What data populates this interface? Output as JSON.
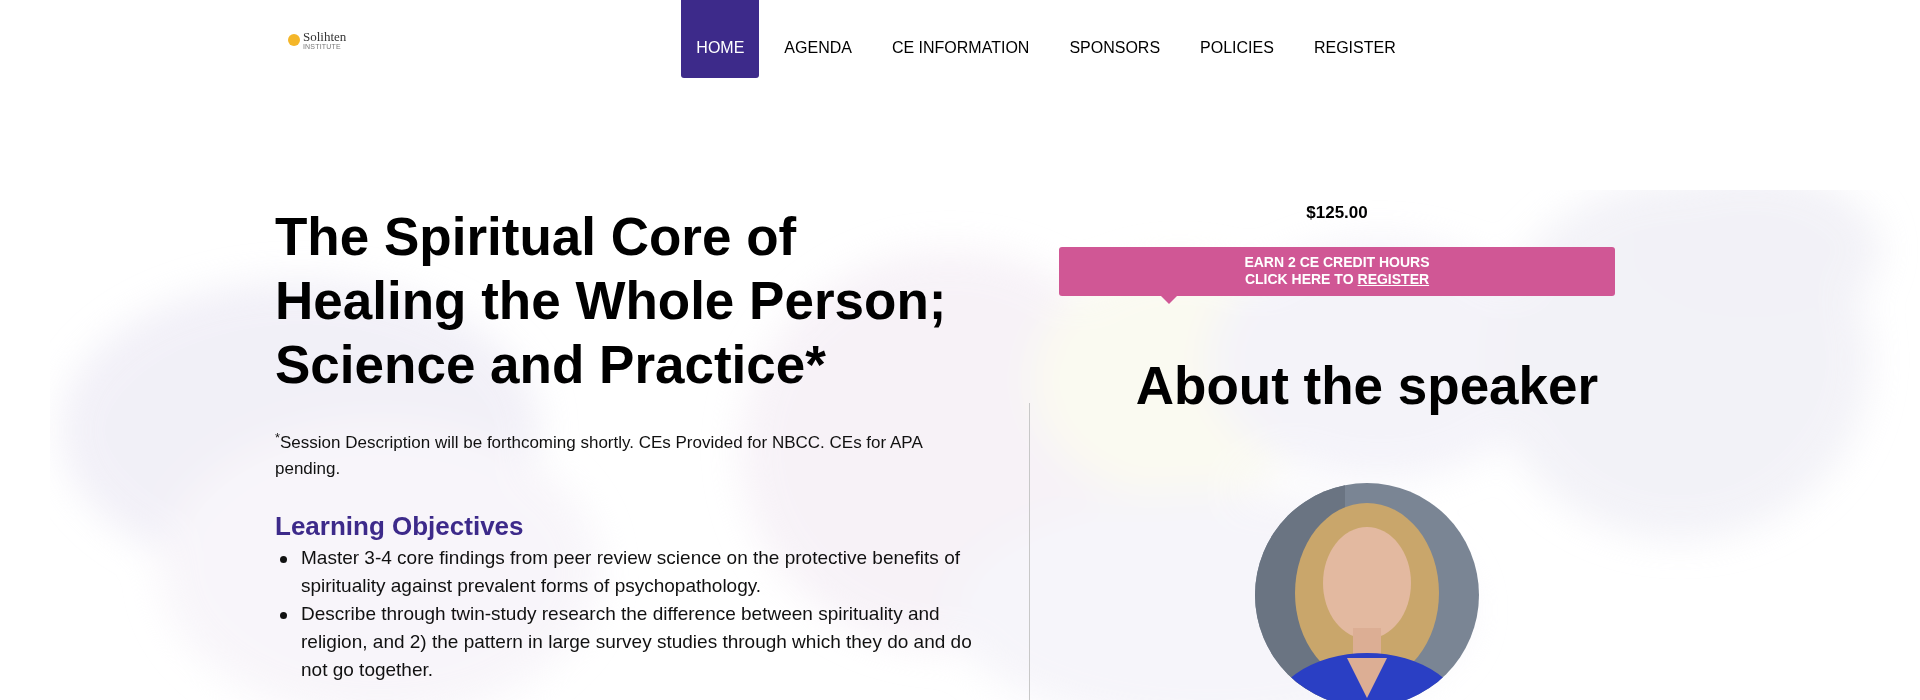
{
  "logo": {
    "name": "Solihten",
    "tagline": "INSTITUTE"
  },
  "nav": [
    {
      "label": "HOME",
      "selected": true
    },
    {
      "label": "AGENDA",
      "selected": false
    },
    {
      "label": "CE INFORMATION",
      "selected": false
    },
    {
      "label": "SPONSORS",
      "selected": false
    },
    {
      "label": "POLICIES",
      "selected": false
    },
    {
      "label": "REGISTER",
      "selected": false
    }
  ],
  "title": "The Spiritual Core of Healing the Whole Person; Science and Practice*",
  "footnote": "$^{*}$Session Description will be forthcoming shortly. CEs Provided for NBCC. CEs for APA pending.",
  "objectives": {
    "heading": "Learning Objectives",
    "items": [
      "Master 3-4 core findings from peer review science on the protective benefits of spirituality against prevalent forms of psychopathology.",
      "Describe through twin-study research the difference between spirituality and religion, and 2) the pattern in large survey studies through which they do and do not go together."
    ]
  },
  "price": "$125.00",
  "banner": {
    "line_1": "EARN 2 CE CREDIT HOURS",
    "line_2": "CLICK HERE TO",
    "link": "REGISTER"
  },
  "speaker": {
    "heading": "About the speaker"
  }
}
